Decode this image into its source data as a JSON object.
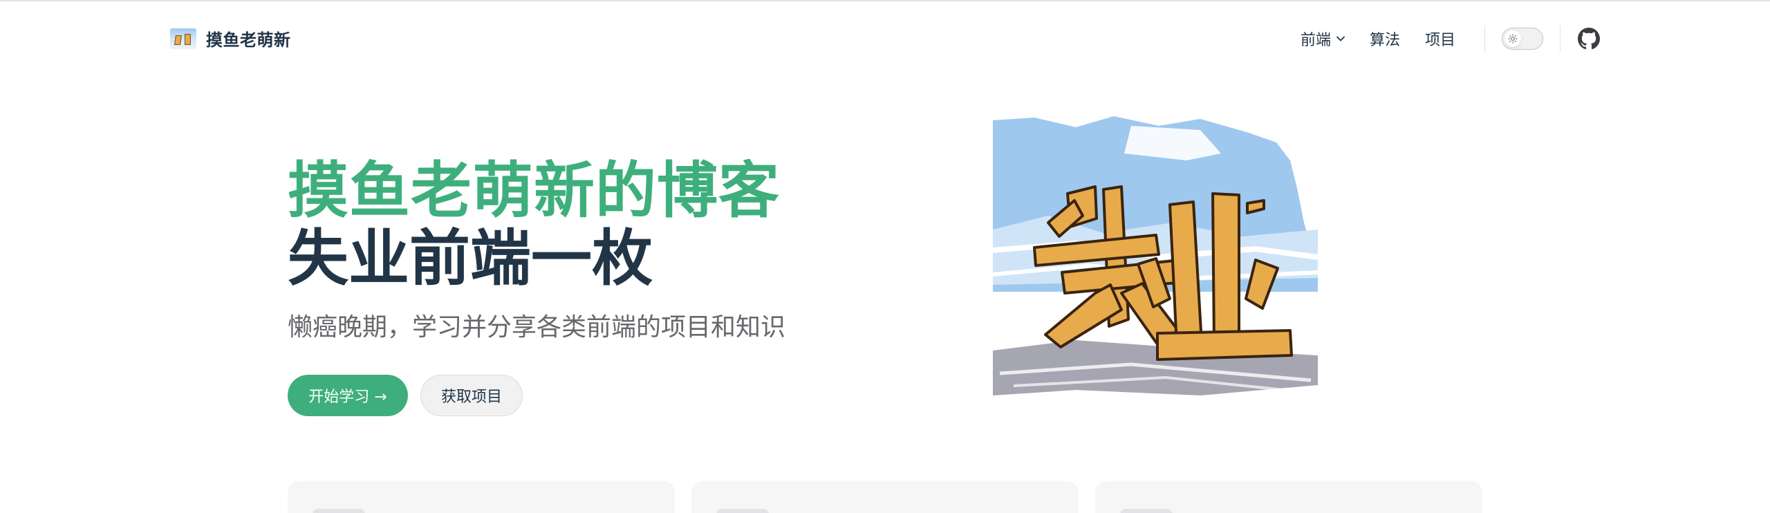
{
  "site": {
    "title": "摸鱼老萌新"
  },
  "nav": {
    "items": [
      {
        "label": "前端",
        "has_dropdown": true
      },
      {
        "label": "算法",
        "has_dropdown": false
      },
      {
        "label": "项目",
        "has_dropdown": false
      }
    ],
    "theme_toggle_icon": "sun-icon",
    "social_icon": "github-icon"
  },
  "hero": {
    "name": "摸鱼老萌新的博客",
    "text": "失业前端一枚",
    "tagline": "懒癌晚期，学习并分享各类前端的项目和知识",
    "image_text": "失业",
    "actions": [
      {
        "label": "开始学习 →",
        "theme": "brand"
      },
      {
        "label": "获取项目",
        "theme": "alt"
      }
    ]
  },
  "features_count": 3,
  "colors": {
    "brand": "#3eaf7c",
    "text": "#213547",
    "muted": "#67676c",
    "image_sky": "#9fc8ef",
    "image_blocks": "#e8ab4c"
  }
}
